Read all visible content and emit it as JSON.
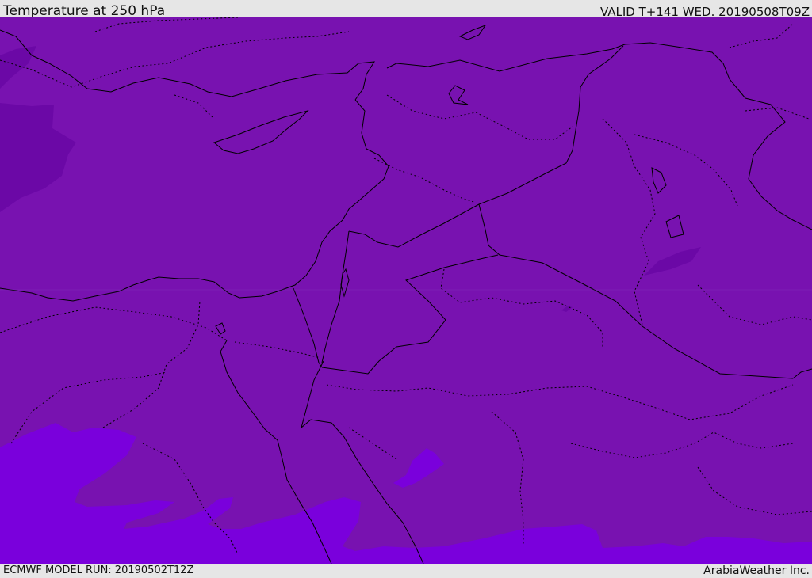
{
  "header": {
    "title": "Temperature at 250 hPa",
    "valid": "VALID T+141 WED. 20190508T09Z"
  },
  "footer": {
    "model_run": "ECMWF MODEL RUN: 20190502T12Z",
    "credit": "ArabiaWeather Inc."
  },
  "colors": {
    "base_fill": "#7812b0",
    "cold_band": "#6b08a6",
    "warm_band": "#7a00dc",
    "border_line": "#000000"
  }
}
